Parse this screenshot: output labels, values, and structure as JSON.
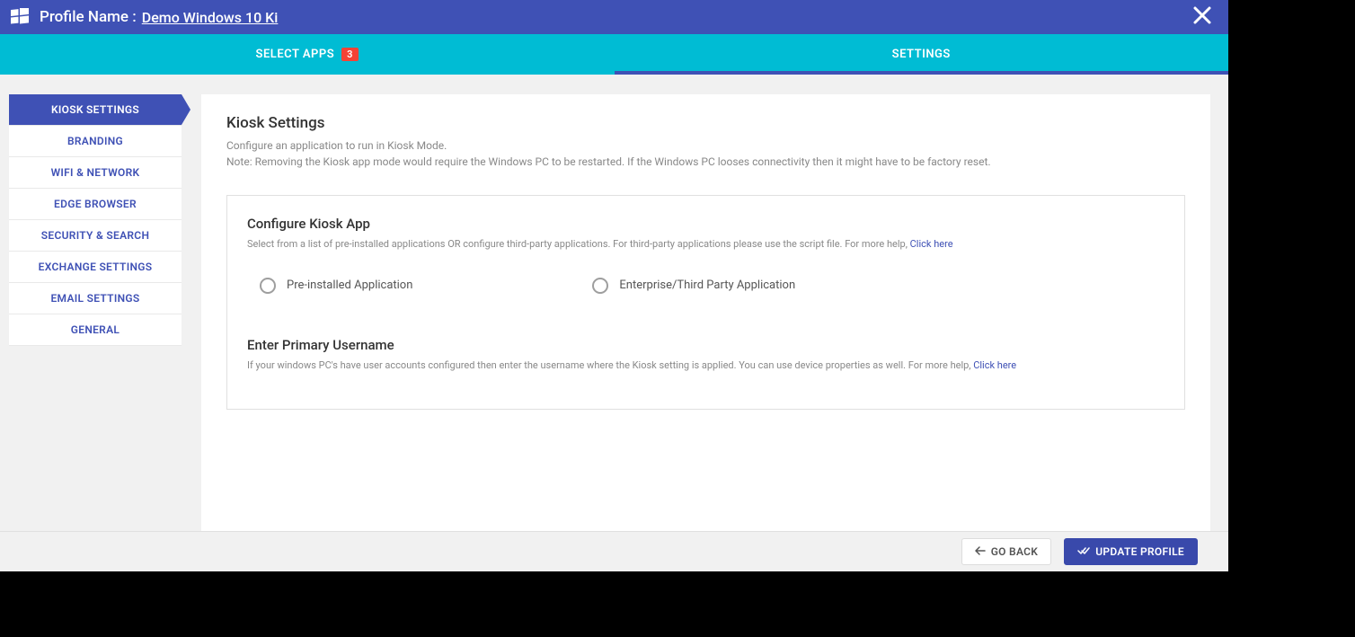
{
  "header": {
    "profileLabel": "Profile Name :",
    "profileName": "Demo Windows 10 Ki"
  },
  "tabs": {
    "selectApps": {
      "label": "SELECT APPS",
      "badge": "3"
    },
    "settings": {
      "label": "SETTINGS"
    }
  },
  "sidebar": {
    "items": [
      {
        "label": "KIOSK SETTINGS",
        "active": true
      },
      {
        "label": "BRANDING"
      },
      {
        "label": "WIFI & NETWORK"
      },
      {
        "label": "EDGE BROWSER"
      },
      {
        "label": "SECURITY & SEARCH"
      },
      {
        "label": "EXCHANGE SETTINGS"
      },
      {
        "label": "EMAIL SETTINGS"
      },
      {
        "label": "GENERAL"
      }
    ]
  },
  "content": {
    "title": "Kiosk Settings",
    "desc1": "Configure an application to run in Kiosk Mode.",
    "desc2": "Note: Removing the Kiosk app mode would require the Windows PC to be restarted. If the Windows PC looses connectivity then it might have to be factory reset.",
    "panel1": {
      "title": "Configure Kiosk App",
      "desc": "Select from a list of pre-installed applications OR configure third-party applications. For third-party applications please use the script file. For more help, ",
      "link": "Click here",
      "opt1": "Pre-installed Application",
      "opt2": "Enterprise/Third Party Application"
    },
    "panel2": {
      "title": "Enter Primary Username",
      "desc": "If your windows PC's have user accounts configured then enter the username where the Kiosk setting is applied. You can use device properties as well. For more help, ",
      "link": "Click here"
    }
  },
  "footer": {
    "back": "GO BACK",
    "update": "UPDATE PROFILE"
  }
}
